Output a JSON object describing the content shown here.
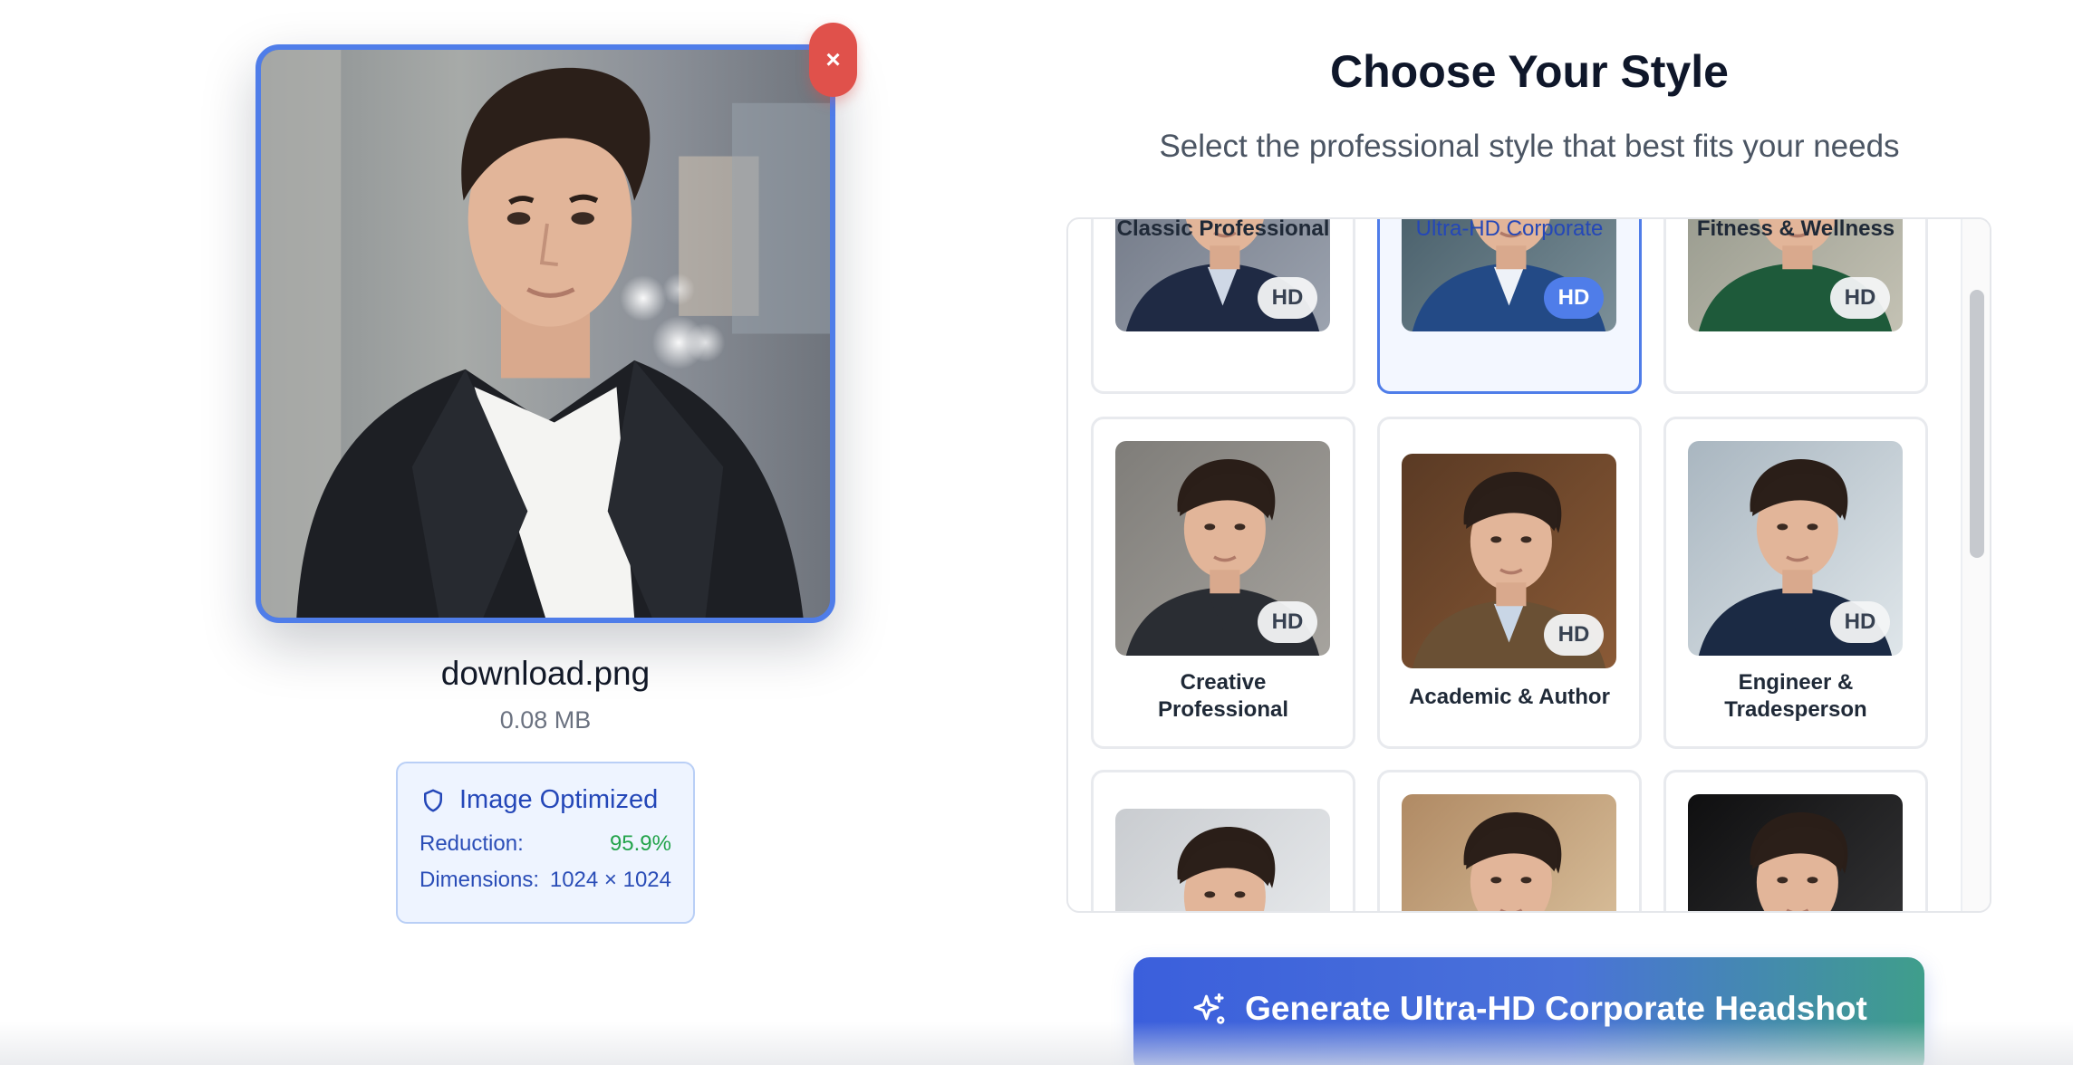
{
  "upload": {
    "file_name": "download.png",
    "file_size": "0.08 MB",
    "remove_label": "×",
    "optimized": {
      "title": "Image Optimized",
      "reduction_label": "Reduction:",
      "reduction_value": "95.9%",
      "dimensions_label": "Dimensions:",
      "dimensions_value": "1024 × 1024"
    }
  },
  "chooser": {
    "title": "Choose Your Style",
    "subtitle": "Select the professional style that best fits your needs",
    "badge": "HD",
    "styles": [
      {
        "label": "Classic Professional",
        "icon": "portrait-navy-suit",
        "selected": false
      },
      {
        "label": "Ultra-HD Corporate",
        "icon": "portrait-blue-suit",
        "selected": true
      },
      {
        "label": "Fitness & Wellness",
        "icon": "portrait-green-shirt",
        "selected": false
      },
      {
        "label": "Creative Professional",
        "icon": "portrait-black-turtleneck",
        "selected": false
      },
      {
        "label": "Academic & Author",
        "icon": "portrait-library-tweed",
        "selected": false
      },
      {
        "label": "Engineer & Tradesperson",
        "icon": "portrait-navy-polo",
        "selected": false
      },
      {
        "label": "",
        "icon": "portrait-office",
        "selected": false
      },
      {
        "label": "",
        "icon": "portrait-warm-interior",
        "selected": false
      },
      {
        "label": "",
        "icon": "portrait-black-and-white",
        "selected": false
      }
    ]
  },
  "actions": {
    "generate_label": "Generate Ultra-HD Corporate Headshot"
  },
  "colors": {
    "accent": "#4f7de9",
    "danger": "#e0514b",
    "success": "#22a34a",
    "gradient_start": "#3b5fdc",
    "gradient_end": "#3f9e8b"
  }
}
